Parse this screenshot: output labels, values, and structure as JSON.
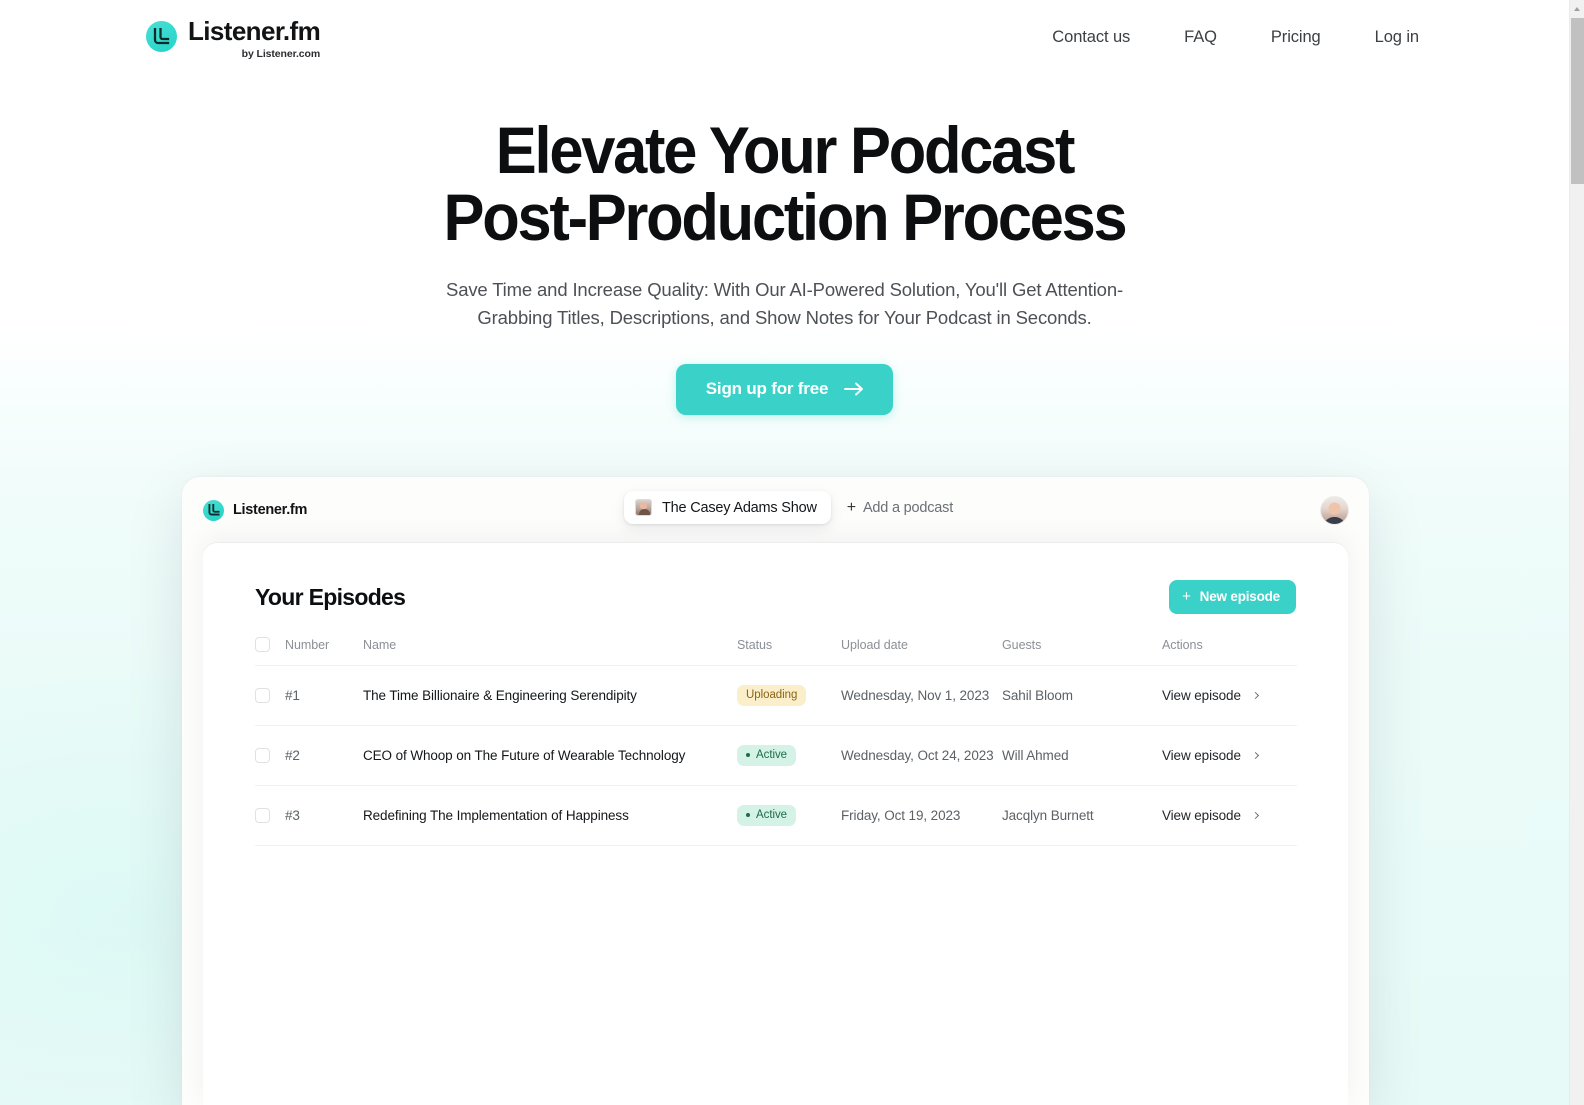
{
  "brand": {
    "name": "Listener.fm",
    "sub": "by Listener.com",
    "accent": "#3ad2c8"
  },
  "nav": {
    "items": [
      {
        "label": "Contact us"
      },
      {
        "label": "FAQ"
      },
      {
        "label": "Pricing"
      },
      {
        "label": "Log in"
      }
    ]
  },
  "hero": {
    "title_line1": "Elevate Your Podcast",
    "title_line2": "Post-Production Process",
    "subtitle": "Save Time and Increase Quality: With Our AI-Powered Solution, You'll Get Attention-Grabbing Titles, Descriptions, and Show Notes for Your Podcast in Seconds.",
    "cta_label": "Sign up for free"
  },
  "app": {
    "brand_name": "Listener.fm",
    "podcast_selected": "The Casey Adams Show",
    "add_podcast_label": "Add a podcast",
    "panel_title": "Your Episodes",
    "new_episode_label": "New episode",
    "table": {
      "headers": [
        "Number",
        "Name",
        "Status",
        "Upload date",
        "Guests",
        "Actions"
      ],
      "rows": [
        {
          "number": "#1",
          "name": "The Time Billionaire & Engineering Serendipity",
          "status": "Uploading",
          "status_kind": "uploading",
          "date": "Wednesday, Nov 1, 2023",
          "guest": "Sahil Bloom",
          "action": "View episode"
        },
        {
          "number": "#2",
          "name": "CEO of Whoop on The Future of Wearable Technology",
          "status": "Active",
          "status_kind": "active",
          "date": "Wednesday, Oct 24, 2023",
          "guest": "Will Ahmed",
          "action": "View episode"
        },
        {
          "number": "#3",
          "name": "Redefining The Implementation of Happiness",
          "status": "Active",
          "status_kind": "active",
          "date": "Friday, Oct 19, 2023",
          "guest": "Jacqlyn Burnett",
          "action": "View episode"
        }
      ]
    }
  }
}
